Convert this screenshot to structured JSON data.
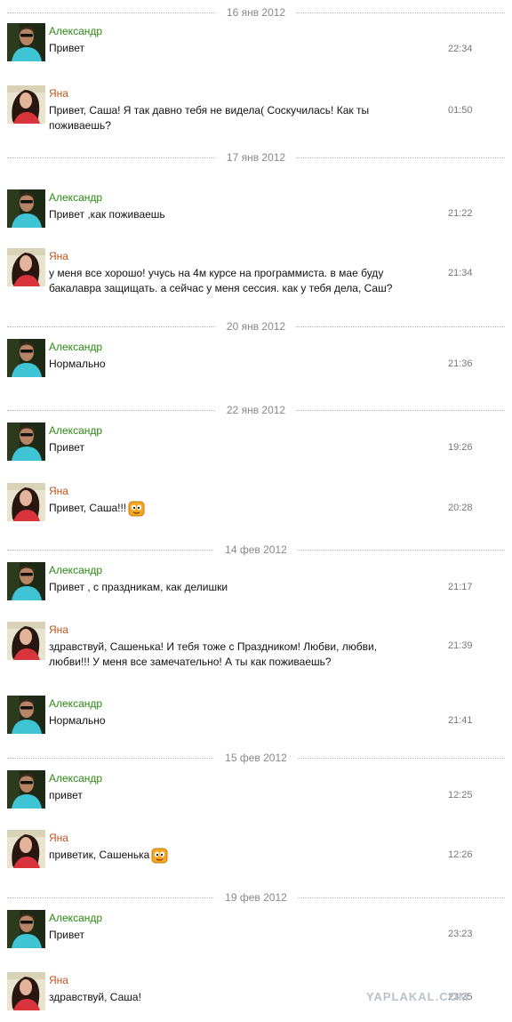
{
  "days": [
    {
      "date": "16 янв 2012",
      "messages": [
        {
          "author": "Александр",
          "gender": "m",
          "text": "Привет",
          "time": "22:34"
        },
        {
          "author": "Яна",
          "gender": "f",
          "text": "Привет, Саша! Я так давно тебя не видела( Соскучилась! Как ты поживаешь?",
          "time": "01:50"
        }
      ]
    },
    {
      "date": "17 янв 2012",
      "messages": [
        {
          "author": "Александр",
          "gender": "m",
          "text": "Привет ,как поживаешь",
          "time": "21:22"
        },
        {
          "author": "Яна",
          "gender": "f",
          "text": "у меня все хорошо! учусь на 4м курсе на программиста. в мае буду бакалавра защищать. а сейчас у меня сессия. как у тебя дела, Саш?",
          "time": "21:34"
        }
      ]
    },
    {
      "date": "20 янв 2012",
      "messages": [
        {
          "author": "Александр",
          "gender": "m",
          "text": "Нормально",
          "time": "21:36"
        }
      ]
    },
    {
      "date": "22 янв 2012",
      "messages": [
        {
          "author": "Александр",
          "gender": "m",
          "text": "Привет",
          "time": "19:26"
        },
        {
          "author": "Яна",
          "gender": "f",
          "text": "Привет, Саша!!!",
          "time": "20:28",
          "smiley": "smiley-icon"
        }
      ]
    },
    {
      "date": "14 фев 2012",
      "messages": [
        {
          "author": "Александр",
          "gender": "m",
          "text": "Привет , с праздникам, как делишки",
          "time": "21:17"
        },
        {
          "author": "Яна",
          "gender": "f",
          "text": "здравствуй, Сашенька! И тебя тоже с Праздником! Любви, любви, любви!!! У меня все замечательно! А ты как поживаешь?",
          "time": "21:39"
        },
        {
          "author": "Александр",
          "gender": "m",
          "text": "Нормально",
          "time": "21:41"
        }
      ]
    },
    {
      "date": "15 фев 2012",
      "messages": [
        {
          "author": "Александр",
          "gender": "m",
          "text": "привет",
          "time": "12:25"
        },
        {
          "author": "Яна",
          "gender": "f",
          "text": "приветик, Сашенька",
          "time": "12:26",
          "smiley": "smiley-icon"
        }
      ]
    },
    {
      "date": "19 фев 2012",
      "messages": [
        {
          "author": "Александр",
          "gender": "m",
          "text": "Привет",
          "time": "23:23"
        },
        {
          "author": "Яна",
          "gender": "f",
          "text": "здравствуй, Саша!",
          "time": "23:25"
        }
      ]
    }
  ],
  "watermark": "YAPLAKAL.COM",
  "colors": {
    "male_name": "#2a8a12",
    "female_name": "#c0561d",
    "separator": "#b5b5b5",
    "date": "#888888"
  }
}
